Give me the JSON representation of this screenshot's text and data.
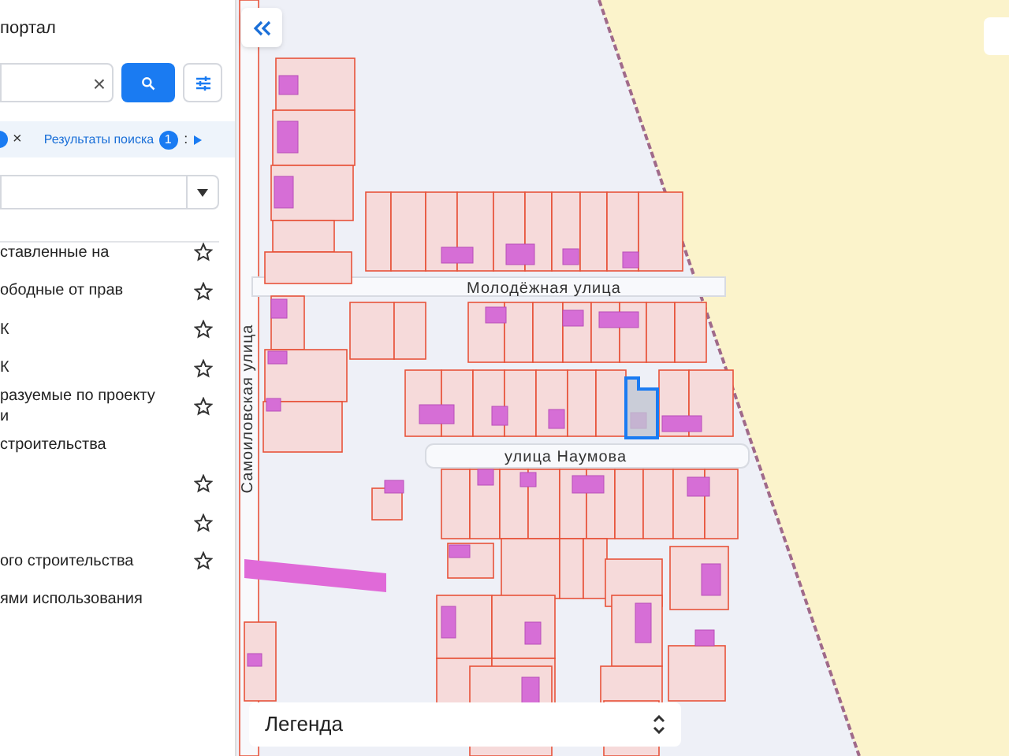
{
  "sidebar": {
    "title": "портал",
    "search": {
      "clear_label": "×"
    },
    "tabs": [
      {
        "kind": "badge-tab",
        "label": "×",
        "selected": false
      },
      {
        "kind": "results-tab",
        "label": "Результаты поиска",
        "count": "1",
        "selected": true
      }
    ],
    "tabs_more": ":",
    "layers": [
      {
        "kind": "layer",
        "text": "ставленные на"
      },
      {
        "kind": "layer",
        "text": "ободные от прав"
      },
      {
        "kind": "layer",
        "text": "К"
      },
      {
        "kind": "layer",
        "text": "К"
      },
      {
        "kind": "layer",
        "text": "разуемые по проекту\nи"
      },
      {
        "kind": "group",
        "text": "строительства"
      },
      {
        "kind": "layer"
      },
      {
        "kind": "layer"
      },
      {
        "kind": "layer",
        "text": "ого строительства"
      },
      {
        "kind": "group",
        "text": "ями использования"
      }
    ]
  },
  "map": {
    "streets": [
      {
        "kind": "vertical",
        "name": "Самоиловская улица"
      },
      {
        "kind": "horizontal",
        "name": "Молодёжная улица"
      },
      {
        "kind": "horizontal",
        "name": "улица Наумова"
      }
    ],
    "legend": {
      "label": "Легенда"
    }
  }
}
